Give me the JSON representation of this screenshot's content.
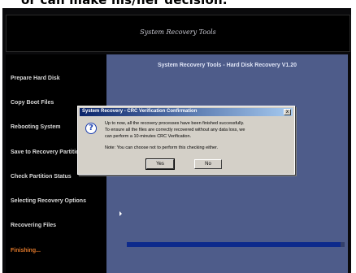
{
  "caption": "or can make his/her decision.",
  "app": {
    "title": "System Recovery Tools"
  },
  "sidebar": {
    "steps": [
      {
        "label": "Prepare Hard Disk"
      },
      {
        "label": "Copy Boot Files"
      },
      {
        "label": "Rebooting System"
      },
      {
        "label": "Save to Recovery Partition"
      },
      {
        "label": "Check Partition Status"
      },
      {
        "label": "Selecting Recovery Options"
      },
      {
        "label": "Recovering Files"
      },
      {
        "label": "Finishing..."
      }
    ],
    "active_index": 7,
    "active_color": "#e0782a"
  },
  "main": {
    "heading": "System Recovery Tools - Hard Disk Recovery V1.20"
  },
  "dialog": {
    "title": "System Recovery - CRC Verification Confirmation",
    "message_lines": [
      "Up to now, all the recovery processes have been finished successfully.",
      "To ensure all the files are correctly recovered without any data loss, we",
      "can perform a 10-minutes CRC Verification."
    ],
    "note": "Note: You can choose not to perform this checking either.",
    "yes_label": "Yes",
    "no_label": "No",
    "icon": "question-icon",
    "close_glyph": "x"
  },
  "progress": {
    "fraction": 0.98,
    "fill_color": "#0d2a8c"
  }
}
